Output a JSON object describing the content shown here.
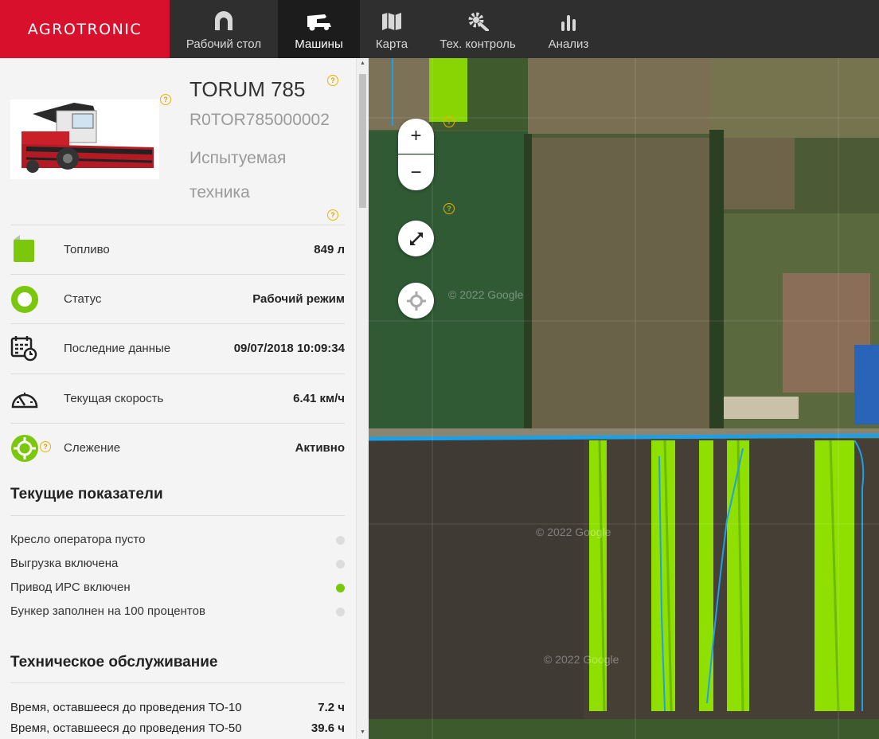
{
  "app": {
    "logo_text": "AGROTRONIC"
  },
  "nav": [
    {
      "label": "Рабочий стол",
      "icon": "arch-icon"
    },
    {
      "label": "Машины",
      "icon": "harvester-icon",
      "active": true
    },
    {
      "label": "Карта",
      "icon": "map-icon"
    },
    {
      "label": "Тех. контроль",
      "icon": "wrench-gear-icon"
    },
    {
      "label": "Анализ",
      "icon": "bar-chart-icon"
    }
  ],
  "machine": {
    "model": "TORUM 785",
    "serial": "R0TOR785000002",
    "group": "Испытуемая техника"
  },
  "help_mark": "?",
  "stats": [
    {
      "label": "Топливо",
      "value": "849 л",
      "icon": "fuel-icon"
    },
    {
      "label": "Статус",
      "value": "Рабочий режим",
      "icon": "status-ring-icon"
    },
    {
      "label": "Последние данные",
      "value": "09/07/2018 10:09:34",
      "icon": "calendar-clock-icon"
    },
    {
      "label": "Текущая скорость",
      "value": "6.41 км/ч",
      "icon": "speedometer-icon"
    },
    {
      "label": "Слежение",
      "value": "Активно",
      "icon": "tracking-icon"
    }
  ],
  "indicators_title": "Текущие показатели",
  "indicators": [
    {
      "label": "Кресло оператора пусто",
      "active": false
    },
    {
      "label": "Выгрузка включена",
      "active": false
    },
    {
      "label": "Привод ИРС включен",
      "active": true
    },
    {
      "label": "Бункер заполнен на 100 процентов",
      "active": false
    }
  ],
  "maintenance_title": "Техническое обслуживание",
  "maintenance": [
    {
      "label": "Время, оставшееся до проведения ТО-10",
      "value": "7.2 ч"
    },
    {
      "label": "Время, оставшееся до проведения ТО-50",
      "value": "39.6 ч"
    }
  ],
  "map": {
    "zoom_in": "+",
    "zoom_out": "−",
    "watermark": "© 2022 Google"
  },
  "colors": {
    "brand_red": "#d9102b",
    "accent_green": "#7ac70c",
    "track_green": "#8fe000",
    "track_blue": "#1ea0e6"
  }
}
